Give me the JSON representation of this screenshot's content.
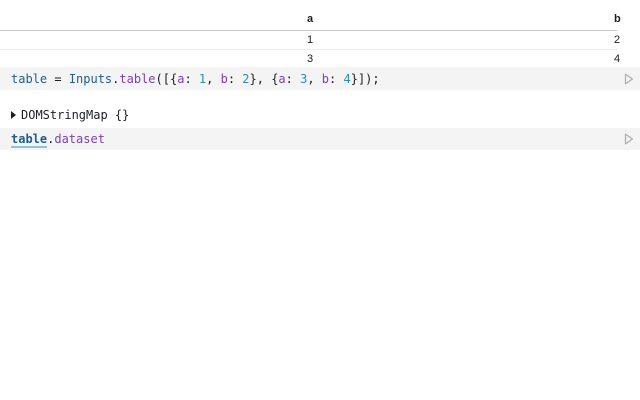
{
  "table": {
    "headers": [
      "a",
      "b"
    ],
    "rows": [
      [
        "1",
        "2"
      ],
      [
        "3",
        "4"
      ]
    ]
  },
  "cells": [
    {
      "tokens": [
        {
          "t": "var",
          "s": "table"
        },
        {
          "t": "op",
          "s": " = "
        },
        {
          "t": "var",
          "s": "Inputs"
        },
        {
          "t": "punc",
          "s": "."
        },
        {
          "t": "prop",
          "s": "table"
        },
        {
          "t": "punc",
          "s": "([{"
        },
        {
          "t": "key",
          "s": "a"
        },
        {
          "t": "punc",
          "s": ": "
        },
        {
          "t": "num",
          "s": "1"
        },
        {
          "t": "punc",
          "s": ", "
        },
        {
          "t": "key",
          "s": "b"
        },
        {
          "t": "punc",
          "s": ": "
        },
        {
          "t": "num",
          "s": "2"
        },
        {
          "t": "punc",
          "s": "}, {"
        },
        {
          "t": "key",
          "s": "a"
        },
        {
          "t": "punc",
          "s": ": "
        },
        {
          "t": "num",
          "s": "3"
        },
        {
          "t": "punc",
          "s": ", "
        },
        {
          "t": "key",
          "s": "b"
        },
        {
          "t": "punc",
          "s": ": "
        },
        {
          "t": "num",
          "s": "4"
        },
        {
          "t": "punc",
          "s": "}]);"
        }
      ]
    },
    {
      "tokens": [
        {
          "t": "ref",
          "s": "table"
        },
        {
          "t": "punc",
          "s": "."
        },
        {
          "t": "prop",
          "s": "dataset"
        }
      ]
    }
  ],
  "inspector": {
    "label": "DOMStringMap {}"
  },
  "icons": {
    "run": "play-icon",
    "expand": "caret-right-icon"
  },
  "colors": {
    "cell_bg": "#f4f4f4",
    "variable": "#1f5d8a",
    "property": "#7b3fb4",
    "number": "#2a8fb8"
  }
}
